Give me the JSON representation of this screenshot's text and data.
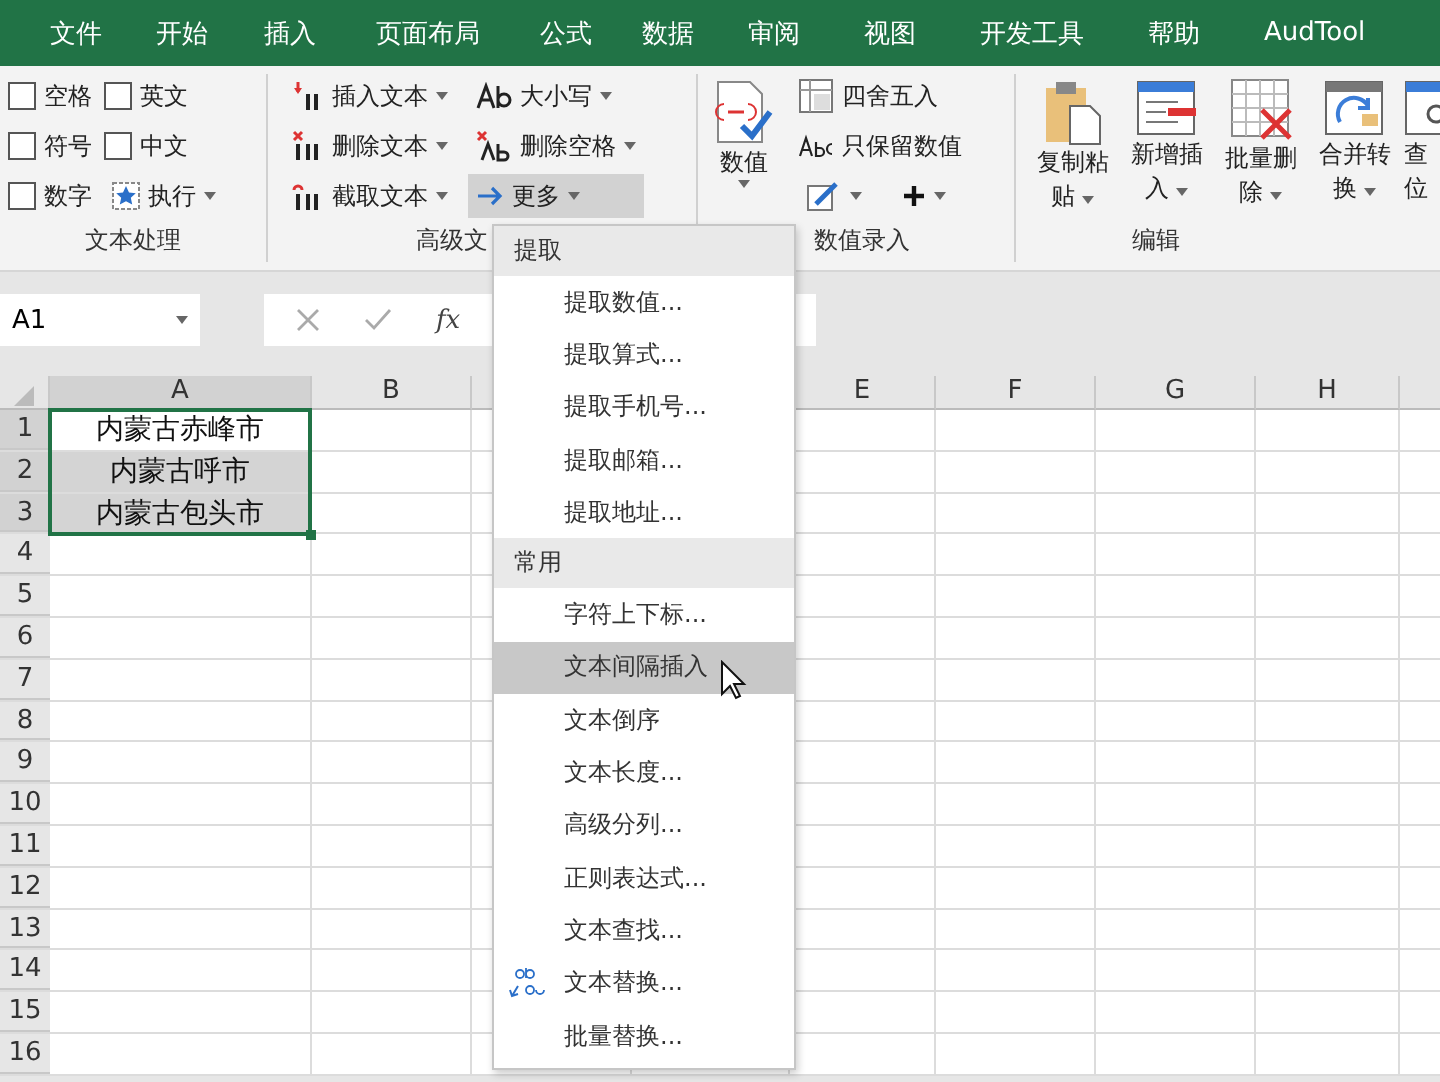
{
  "menu_tabs": [
    "文件",
    "开始",
    "插入",
    "页面布局",
    "公式",
    "数据",
    "审阅",
    "视图",
    "开发工具",
    "帮助",
    "AudTool"
  ],
  "ribbon": {
    "text_processing": {
      "label": "文本处理",
      "checkboxes": [
        {
          "label": "空格",
          "checked": false
        },
        {
          "label": "英文",
          "checked": false
        },
        {
          "label": "符号",
          "checked": false
        },
        {
          "label": "中文",
          "checked": false
        },
        {
          "label": "数字",
          "checked": false
        }
      ],
      "run_button": "执行"
    },
    "advanced_text": {
      "label": "高级文",
      "buttons": [
        {
          "label": "插入文本",
          "kind": "insert",
          "pressed": false
        },
        {
          "label": "大小写",
          "kind": "case",
          "pressed": false
        },
        {
          "label": "删除文本",
          "kind": "delete",
          "pressed": false
        },
        {
          "label": "删除空格",
          "kind": "trim",
          "pressed": false
        },
        {
          "label": "截取文本",
          "kind": "cut",
          "pressed": false
        },
        {
          "label": "更多",
          "kind": "more",
          "pressed": true
        }
      ]
    },
    "number_entry": {
      "label": "数值录入",
      "big_button": "数值",
      "buttons": [
        {
          "label": "四舍五入",
          "kind": "round"
        },
        {
          "label": "只保留数值",
          "kind": "keep"
        }
      ]
    },
    "edit": {
      "label": "编辑",
      "buttons": [
        {
          "lines": [
            "复制粘",
            "贴"
          ],
          "kind": "copy"
        },
        {
          "lines": [
            "新增插",
            "入"
          ],
          "kind": "insert"
        },
        {
          "lines": [
            "批量删",
            "除"
          ],
          "kind": "delete"
        },
        {
          "lines": [
            "合并转",
            "换"
          ],
          "kind": "merge"
        },
        {
          "lines": [
            "查",
            "位"
          ],
          "kind": "find"
        }
      ]
    }
  },
  "name_box": "A1",
  "function_label": "fx",
  "columns": [
    "A",
    "B",
    "E",
    "F",
    "G",
    "H"
  ],
  "rows": [
    {
      "header": "1",
      "value": "内蒙古赤峰市",
      "selected": true,
      "active": true
    },
    {
      "header": "2",
      "value": "内蒙古呼市",
      "selected": true,
      "active": false
    },
    {
      "header": "3",
      "value": "内蒙古包头市",
      "selected": true,
      "active": false
    },
    {
      "header": "4",
      "selected": false
    },
    {
      "header": "5",
      "selected": false
    },
    {
      "header": "6",
      "selected": false
    },
    {
      "header": "7",
      "selected": false
    },
    {
      "header": "8",
      "selected": false
    },
    {
      "header": "9",
      "selected": false
    },
    {
      "header": "10",
      "selected": false
    },
    {
      "header": "11",
      "selected": false
    },
    {
      "header": "12",
      "selected": false
    },
    {
      "header": "13",
      "selected": false
    },
    {
      "header": "14",
      "selected": false
    },
    {
      "header": "15",
      "selected": false
    },
    {
      "header": "16",
      "selected": false
    }
  ],
  "dropdown": {
    "sections": [
      {
        "title": "提取",
        "items": [
          {
            "label": "提取数值...",
            "kind": "plain",
            "highlighted": false
          },
          {
            "label": "提取算式...",
            "kind": "plain",
            "highlighted": false
          },
          {
            "label": "提取手机号...",
            "kind": "plain",
            "highlighted": false
          },
          {
            "label": "提取邮箱...",
            "kind": "plain",
            "highlighted": false
          },
          {
            "label": "提取地址...",
            "kind": "plain",
            "highlighted": false
          }
        ]
      },
      {
        "title": "常用",
        "items": [
          {
            "label": "字符上下标...",
            "kind": "plain",
            "highlighted": false
          },
          {
            "label": "文本间隔插入",
            "kind": "plain",
            "highlighted": true
          },
          {
            "label": "文本倒序",
            "kind": "plain",
            "highlighted": false
          },
          {
            "label": "文本长度...",
            "kind": "plain",
            "highlighted": false
          },
          {
            "label": "高级分列...",
            "kind": "plain",
            "highlighted": false
          },
          {
            "label": "正则表达式...",
            "kind": "plain",
            "highlighted": false
          },
          {
            "label": "文本查找...",
            "kind": "plain",
            "highlighted": false
          },
          {
            "label": "文本替换...",
            "kind": "replace",
            "highlighted": false
          },
          {
            "label": "批量替换...",
            "kind": "plain",
            "highlighted": false
          }
        ]
      }
    ]
  }
}
